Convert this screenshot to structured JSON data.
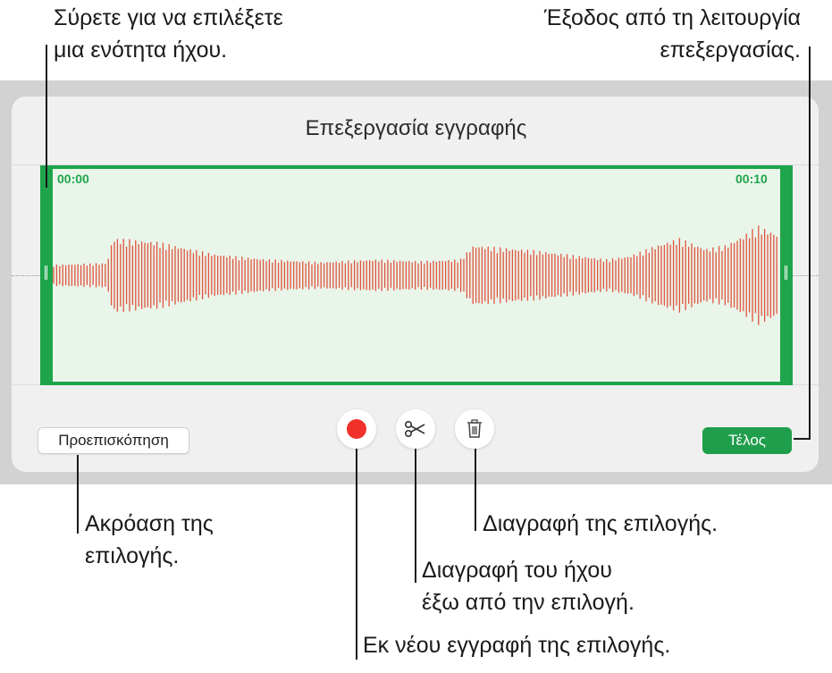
{
  "dialog": {
    "title": "Επεξεργασία εγγραφής",
    "time_start": "00:00",
    "time_end": "00:10",
    "preview_label": "Προεπισκόπηση",
    "done_label": "Τέλος",
    "colors": {
      "accent_green": "#1ea54b",
      "waveform": "#e0533f",
      "record": "#f0312b"
    }
  },
  "icons": {
    "record": "record-icon",
    "trim": "scissors-icon",
    "delete": "trash-icon"
  },
  "callouts": {
    "drag_select": [
      "Σύρετε για να επιλέξετε",
      "μια ενότητα ήχου."
    ],
    "exit_edit": [
      "Έξοδος από τη λειτουργία",
      "επεξεργασίας."
    ],
    "listen": [
      "Ακρόαση της",
      "επιλογής."
    ],
    "delete_selection": "Διαγραφή της επιλογής.",
    "trim_outside": [
      "Διαγραφή του ήχου",
      "έξω από την επιλογή."
    ],
    "rerecord": "Εκ νέου εγγραφή της επιλογής."
  }
}
